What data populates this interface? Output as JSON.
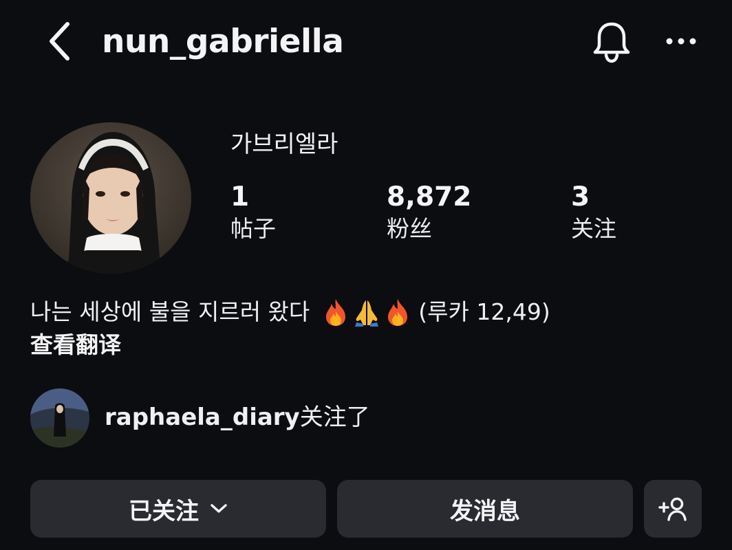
{
  "header": {
    "username": "nun_gabriella",
    "icons": [
      "back-arrow-icon",
      "bell-icon",
      "more-options-icon"
    ]
  },
  "profile": {
    "display_name": "가브리엘라",
    "stats": [
      {
        "value": "1",
        "label": "帖子"
      },
      {
        "value": "8,872",
        "label": "粉丝"
      },
      {
        "value": "3",
        "label": "关注"
      }
    ]
  },
  "bio": {
    "text": "나는 세상에 불을 지르러 왔다",
    "emojis": [
      "fire-emoji",
      "praying-hands-emoji",
      "fire-emoji"
    ],
    "reference": "(루카 12,49)",
    "translate_label": "查看翻译"
  },
  "mutual": {
    "username": "raphaela_diary",
    "suffix": "关注了"
  },
  "actions": {
    "following_label": "已关注",
    "message_label": "发消息",
    "suggest_icon": "add-person-icon"
  },
  "colors": {
    "background": "#0c0d10",
    "button": "#2a2b30",
    "text": "#f2f2f4"
  }
}
